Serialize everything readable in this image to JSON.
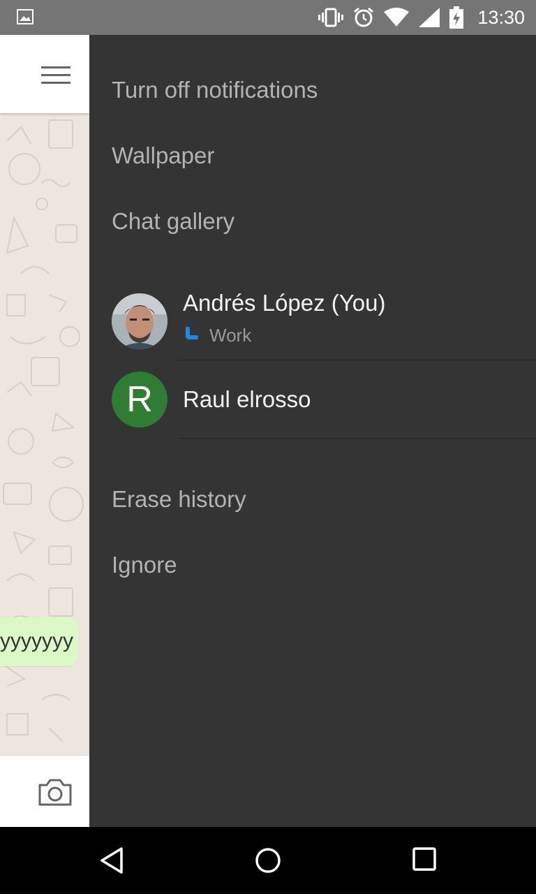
{
  "status_bar": {
    "time": "13:30",
    "icons": [
      "image-notification-icon",
      "vibrate-icon",
      "alarm-icon",
      "wifi-icon",
      "signal-icon",
      "battery-charging-icon"
    ]
  },
  "chat": {
    "bubble_text": "yyyyyyy",
    "menu_icon": "hamburger-menu-icon",
    "camera_icon": "camera-icon"
  },
  "drawer": {
    "top_items": [
      "Turn off notifications",
      "Wallpaper",
      "Chat gallery"
    ],
    "members": [
      {
        "name": "Andrés López (You)",
        "status": "Work",
        "avatar": "photo"
      },
      {
        "name": "Raul elrosso",
        "avatar_letter": "R"
      }
    ],
    "bottom_items": [
      "Erase history",
      "Ignore"
    ]
  },
  "colors": {
    "drawer_bg": "#343434",
    "status_bar": "#757575",
    "avatar_green": "#2e7d32",
    "bubble": "#dcf8c6"
  },
  "nav_bar": [
    "back-icon",
    "home-icon",
    "recents-icon"
  ]
}
